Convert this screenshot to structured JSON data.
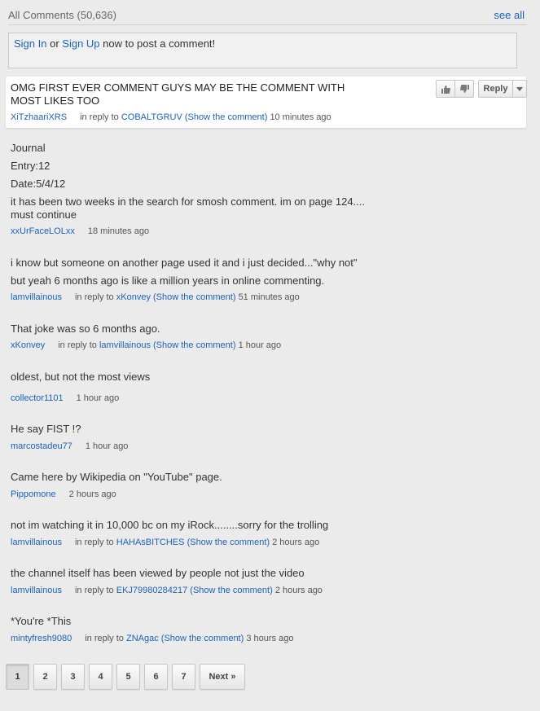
{
  "header": {
    "title": "All Comments (50,636)",
    "see_all": "see all"
  },
  "signin": {
    "sign_in": "Sign In",
    "or": " or ",
    "sign_up": "Sign Up",
    "rest": " now to post a comment!"
  },
  "top_comment": {
    "text": "OMG FIRST EVER COMMENT GUYS MAY BE THE COMMENT WITH MOST LIKES TOO",
    "author": "XiTzhaariXRS",
    "in_reply_to": "in reply to",
    "reply_user": "COBALTGRUV",
    "show": "(Show the comment)",
    "time": "10 minutes ago",
    "reply_label": "Reply"
  },
  "comments": [
    {
      "lines": [
        "Journal",
        "Entry:12",
        "Date:5/4/12",
        "it has been two weeks in the search for smosh comment. im on page 124....",
        "must continue"
      ],
      "author": "xxUrFaceLOLxx",
      "time": "18 minutes ago"
    },
    {
      "lines": [
        "i know but someone on another page used it and i just decided...\"why not\"",
        "but yeah 6 months ago is like a million years in online commenting."
      ],
      "author": "lamvillainous",
      "in_reply_to": "in reply to",
      "reply_user": "xKonvey",
      "show": "(Show the comment)",
      "time": "51 minutes ago"
    },
    {
      "lines": [
        "That joke was so 6 months ago."
      ],
      "author": "xKonvey",
      "in_reply_to": "in reply to",
      "reply_user": "lamvillainous",
      "show": "(Show the comment)",
      "time": "1 hour ago"
    },
    {
      "lines": [
        "oldest, but not the most views"
      ],
      "author": "collector1101",
      "time": "1 hour ago"
    },
    {
      "lines": [
        "He say FIST !?"
      ],
      "author": "marcostadeu77",
      "time": "1 hour ago"
    },
    {
      "lines": [
        "Came here by Wikipedia on \"YouTube\" page."
      ],
      "author": "Pippomone",
      "time": "2 hours ago"
    },
    {
      "lines": [
        "not im watching it in 10,000 bc on my iRock........sorry for the trolling"
      ],
      "author": "lamvillainous",
      "in_reply_to": "in reply to",
      "reply_user": "HAHAsBITCHES",
      "show": "(Show the comment)",
      "time": "2 hours ago"
    },
    {
      "lines": [
        "the channel itself has been viewed by people not just the video"
      ],
      "author": "lamvillainous",
      "in_reply_to": "in reply to",
      "reply_user": "EKJ79980284217",
      "show": "(Show the comment)",
      "time": "2 hours ago"
    },
    {
      "lines": [
        "*You're *This"
      ],
      "author": "mintyfresh9080",
      "in_reply_to": "in reply to",
      "reply_user": "ZNAgac",
      "show": "(Show the comment)",
      "time": "3 hours ago"
    }
  ],
  "pagination": {
    "pages": [
      "1",
      "2",
      "3",
      "4",
      "5",
      "6",
      "7"
    ],
    "current": "1",
    "next": "Next »"
  },
  "colors": {
    "link": "#1c62b9",
    "background": "#ebebeb"
  }
}
